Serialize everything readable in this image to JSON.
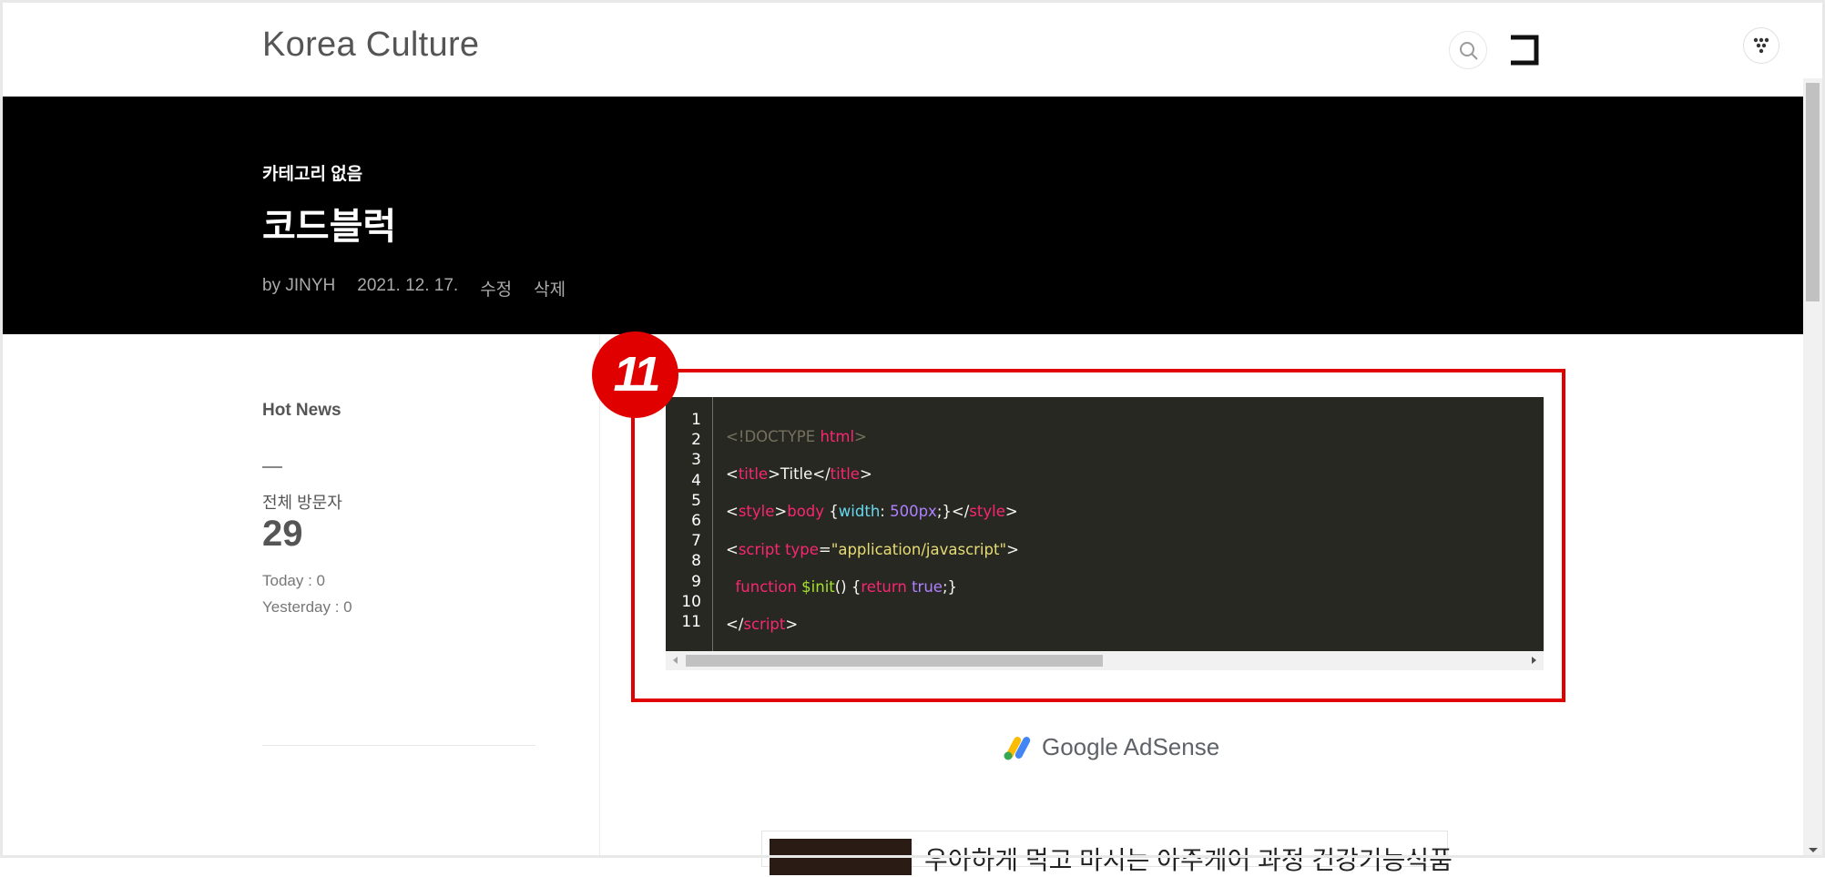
{
  "header": {
    "site_title": "Korea Culture",
    "search_icon": "search-icon",
    "square_icon": "square-icon",
    "menu_icon": "menu-dots-icon"
  },
  "post": {
    "category": "카테고리 없음",
    "title": "코드블럭",
    "author": "by JINYH",
    "date": "2021. 12. 17.",
    "edit_label": "수정",
    "delete_label": "삭제"
  },
  "sidebar": {
    "hot_news": "Hot News",
    "visitors_label": "전체 방문자",
    "total": "29",
    "today": "Today : 0",
    "yesterday": "Yesterday : 0"
  },
  "annotation": {
    "badge": "11",
    "color": "#e10000"
  },
  "code_block": {
    "line_numbers": [
      "1",
      "2",
      "3",
      "4",
      "5",
      "6",
      "7",
      "8",
      "9",
      "10",
      "11"
    ],
    "background": "#272822"
  },
  "adsense": {
    "text_google": "Google",
    "text_adsense": "AdSense"
  },
  "related": {
    "title": "우아하게 먹고 마시는 아주케어 과정 건강기능식품"
  }
}
